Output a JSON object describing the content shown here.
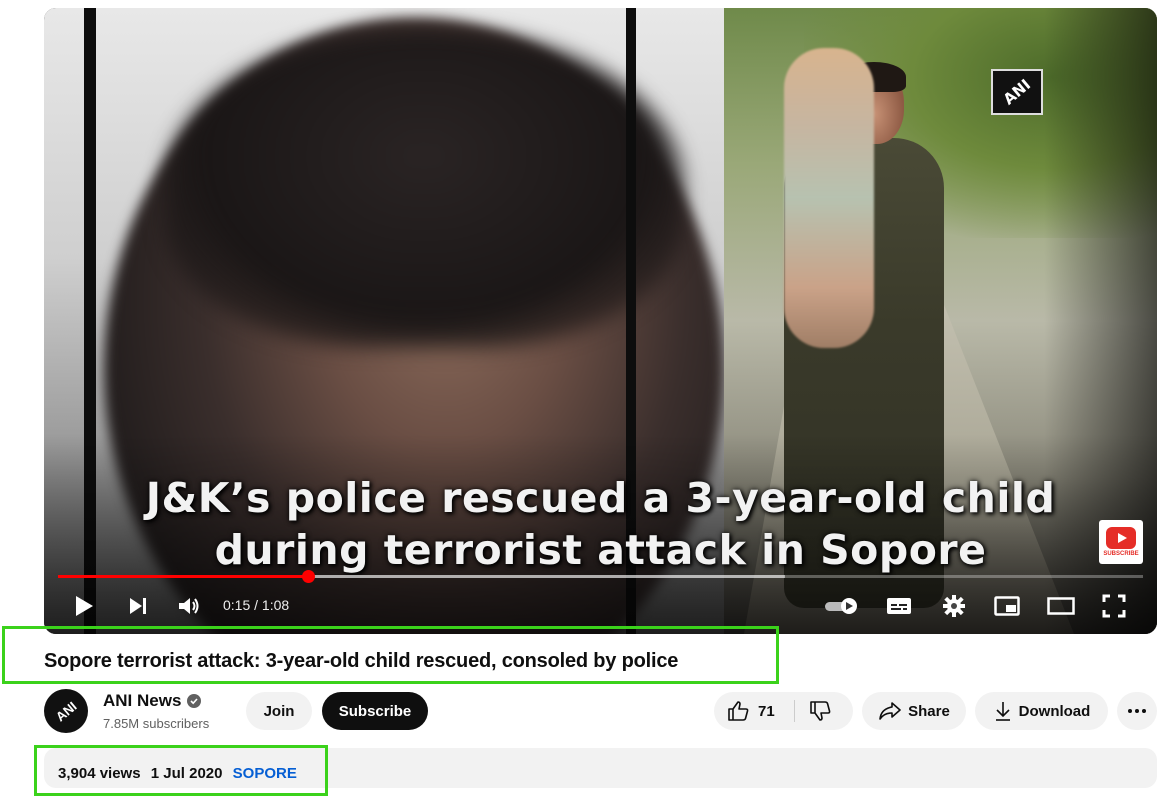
{
  "player": {
    "caption_line1": "J&K’s police rescued a 3-year-old child",
    "caption_line2": "during terrorist attack in Sopore",
    "watermark": "ANI",
    "subscribe_badge": "SUBSCRIBE",
    "time": "0:15 / 1:08",
    "progress_played": 0.23,
    "progress_loaded": 0.67
  },
  "video": {
    "title": "Sopore terrorist attack: 3-year-old child rescued, consoled by police"
  },
  "channel": {
    "avatar_text": "ANI",
    "name": "ANI News",
    "subscribers": "7.85M subscribers",
    "join_label": "Join",
    "subscribe_label": "Subscribe"
  },
  "actions": {
    "likes": "71",
    "share_label": "Share",
    "download_label": "Download"
  },
  "description": {
    "views": "3,904 views",
    "date": "1 Jul 2020",
    "hashtag": "SOPORE"
  },
  "colors": {
    "accent_red": "#ff0000",
    "highlight_green": "#3bd21b",
    "link_blue": "#065fd4"
  }
}
